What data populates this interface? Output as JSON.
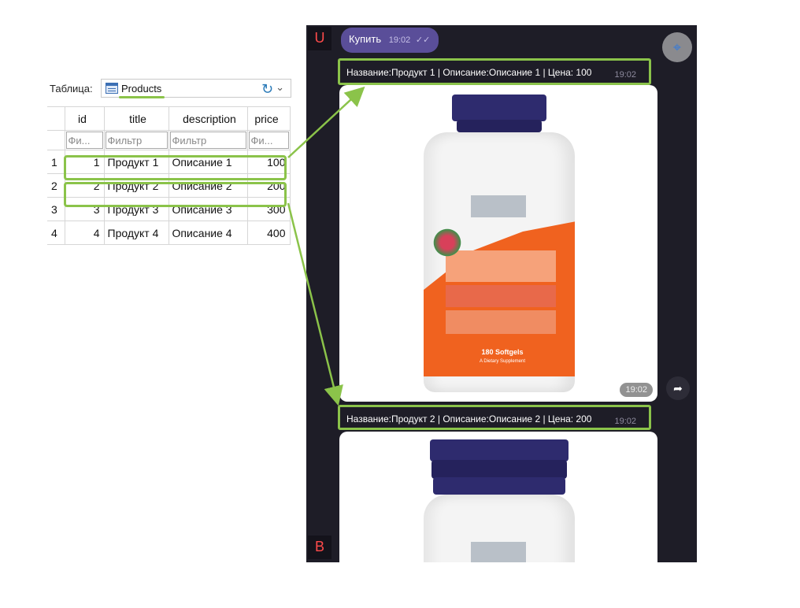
{
  "db": {
    "table_label": "Таблица:",
    "selected_table": "Products",
    "columns": [
      "id",
      "title",
      "description",
      "price"
    ],
    "filters": [
      "Фи...",
      "Фильтр",
      "Фильтр",
      "Фи..."
    ],
    "rows": [
      {
        "num": "1",
        "id": "1",
        "title": "Продукт 1",
        "description": "Описание 1",
        "price": "100"
      },
      {
        "num": "2",
        "id": "2",
        "title": "Продукт 2",
        "description": "Описание 2",
        "price": "200"
      },
      {
        "num": "3",
        "id": "3",
        "title": "Продукт 3",
        "description": "Описание 3",
        "price": "300"
      },
      {
        "num": "4",
        "id": "4",
        "title": "Продукт 4",
        "description": "Описание 4",
        "price": "400"
      }
    ]
  },
  "chat": {
    "avatar_top": "U",
    "avatar_bottom": "B",
    "buy_button": {
      "label": "Купить",
      "time": "19:02",
      "checks": "✓✓"
    },
    "messages": [
      {
        "text": "Название:Продукт 1 | Описание:Описание 1 | Цена: 100",
        "time": "19:02"
      },
      {
        "text": "Название:Продукт 2 | Описание:Описание 2 | Цена: 200",
        "time": "19:02"
      }
    ],
    "photo1_time": "19:02",
    "photo1_caption": "180 Softgels",
    "photo1_subcaption": "A Dietary Supplement"
  },
  "colors": {
    "highlight": "#8bc34a",
    "chat_bg": "#1e1d27",
    "button_bg": "#5a4e99",
    "cap": "#2e2b6e",
    "label_orange": "#f0621f"
  }
}
